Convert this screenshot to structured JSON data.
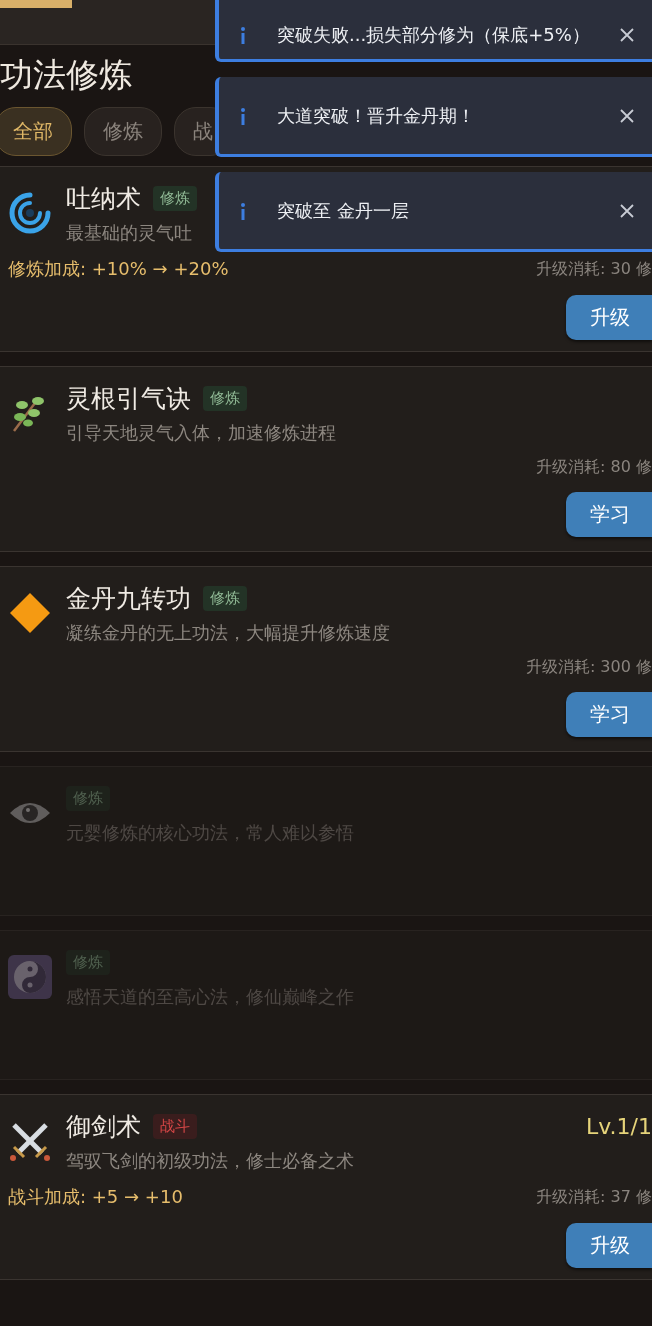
{
  "title": "功法修炼",
  "tabs": [
    {
      "label": "全部",
      "selected": true
    },
    {
      "label": "修炼",
      "selected": false
    },
    {
      "label": "战",
      "selected": false
    }
  ],
  "techniques": [
    {
      "name": "吐纳术",
      "tag": {
        "label": "修炼",
        "kind": "cultivation"
      },
      "description": "最基础的灵气吐",
      "bonus": "修炼加成: +10% → +20%",
      "cost": "升级消耗: 30 修",
      "button": "升级",
      "locked": false
    },
    {
      "name": "灵根引气诀",
      "tag": {
        "label": "修炼",
        "kind": "cultivation"
      },
      "description": "引导天地灵气入体，加速修炼进程",
      "cost": "升级消耗: 80 修",
      "button": "学习",
      "locked": false
    },
    {
      "name": "金丹九转功",
      "tag": {
        "label": "修炼",
        "kind": "cultivation"
      },
      "description": "凝练金丹的无上功法，大幅提升修炼速度",
      "cost": "升级消耗: 300 修",
      "button": "学习",
      "locked": false
    },
    {
      "tag": {
        "label": "修炼",
        "kind": "cultivation"
      },
      "description": "元婴修炼的核心功法，常人难以参悟",
      "locked": true
    },
    {
      "tag": {
        "label": "修炼",
        "kind": "cultivation"
      },
      "description": "感悟天道的至高心法，修仙巅峰之作",
      "locked": true
    },
    {
      "name": "御剑术",
      "tag": {
        "label": "战斗",
        "kind": "combat"
      },
      "level": "Lv.1/1",
      "description": "驾驭飞剑的初级功法，修士必备之术",
      "bonus": "战斗加成: +5 → +10",
      "cost": "升级消耗: 37 修",
      "button": "升级",
      "locked": false
    }
  ],
  "toasts": [
    {
      "message": "突破失败...损失部分修为（保底+5%）"
    },
    {
      "message": "大道突破！晋升金丹期！"
    },
    {
      "message": "突破至 金丹一层"
    }
  ]
}
